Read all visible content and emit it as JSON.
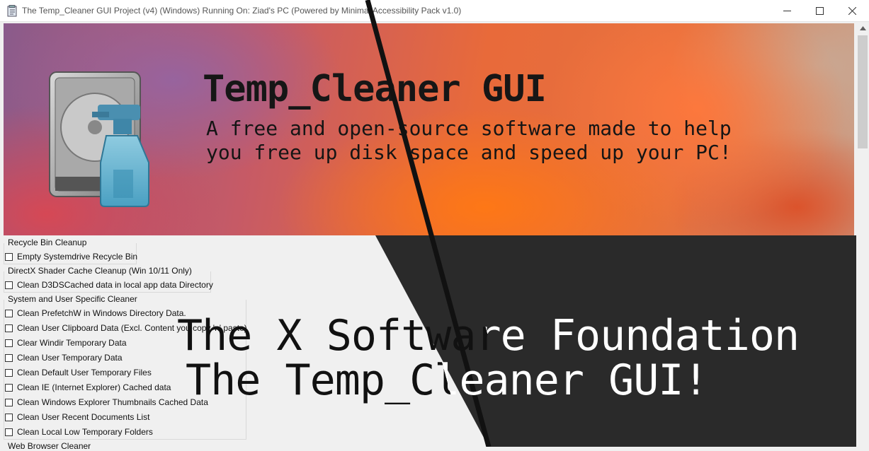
{
  "window": {
    "title": "The Temp_Cleaner GUI Project (v4) (Windows) Running On: Ziad's PC (Powered by Minimal Accessibility Pack v1.0)",
    "controls": {
      "minimize": "—",
      "maximize": "☐",
      "close": "✕"
    }
  },
  "banner": {
    "title": "Temp_Cleaner GUI",
    "subtitle": "A free and open-source software made to help you free up disk space and speed up your PC!",
    "icon": "hdd-spray-bottle-icon"
  },
  "groups": [
    {
      "title": "Recycle Bin Cleanup",
      "items": [
        "Empty Systemdrive Recycle Bin"
      ]
    },
    {
      "title": "DirectX Shader Cache Cleanup (Win 10/11 Only)",
      "items": [
        "Clean D3DSCached data in local app data Directory"
      ]
    },
    {
      "title": "System and User Specific Cleaner",
      "items": [
        "Clean PrefetchW in Windows Directory Data.",
        "Clean User Clipboard Data (Excl. Content you copy 'n' paste)",
        "Clear Windir Temporary Data",
        "Clean User Temporary Data",
        "Clean Default User Temporary Files",
        "Clean IE (Internet Explorer) Cached data",
        "Clean Windows Explorer Thumbnails Cached Data",
        "Clean User Recent Documents List",
        "Clean Local Low Temporary Folders"
      ]
    },
    {
      "title": "Web Browser Cleaner",
      "items": []
    }
  ],
  "overlay": {
    "line1": "The X Software Foundation",
    "line2": "The Temp_Cleaner GUI!"
  },
  "colors": {
    "dark_panel": "#2a2a2a",
    "diagonal_line": "#111111"
  }
}
